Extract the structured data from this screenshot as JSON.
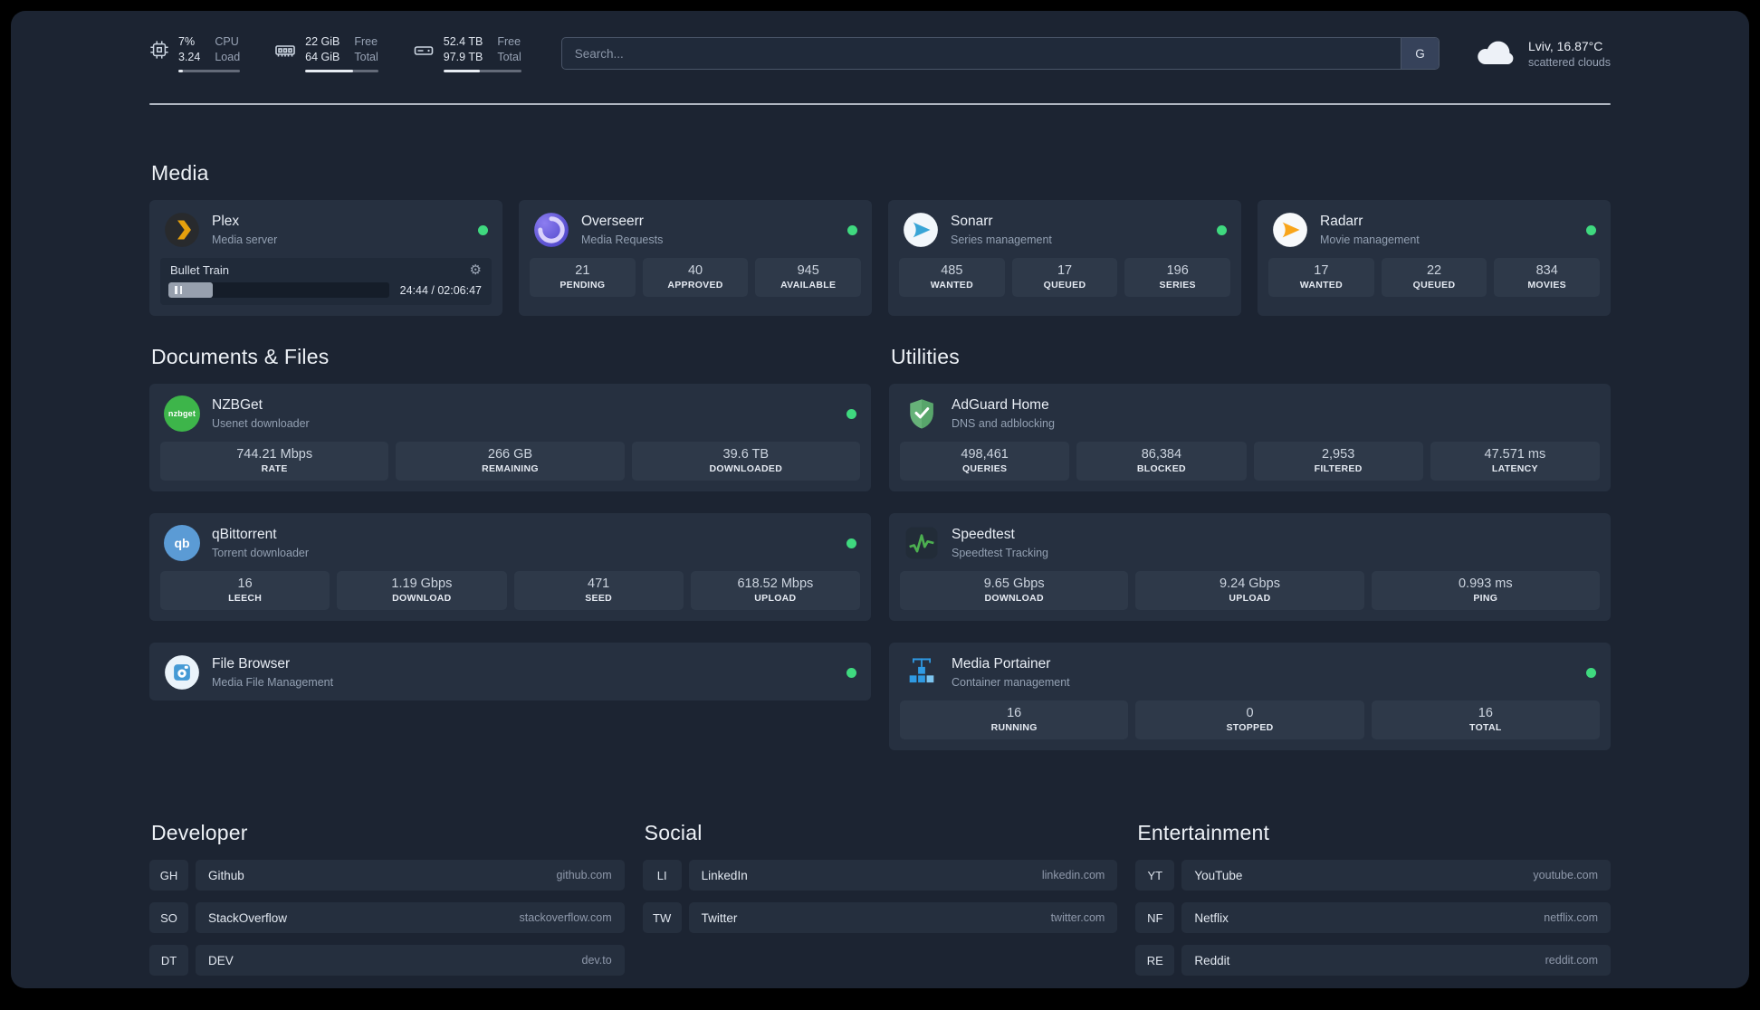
{
  "icons": {
    "gear": "⚙"
  },
  "topbar": {
    "cpu": {
      "value_top": "7%",
      "value_bottom": "3.24",
      "label_top": "CPU",
      "label_bottom": "Load",
      "progress": 7
    },
    "memory": {
      "value_top": "22 GiB",
      "value_bottom": "64 GiB",
      "label_top": "Free",
      "label_bottom": "Total",
      "progress": 66
    },
    "disk": {
      "value_top": "52.4 TB",
      "value_bottom": "97.9 TB",
      "label_top": "Free",
      "label_bottom": "Total",
      "progress": 47
    },
    "search": {
      "placeholder": "Search...",
      "provider_label": "G"
    },
    "weather": {
      "location": "Lviv, 16.87°C",
      "condition": "scattered clouds"
    }
  },
  "sections": {
    "media": {
      "title": "Media",
      "plex": {
        "title": "Plex",
        "subtitle": "Media server",
        "now_playing": "Bullet Train",
        "time": "24:44 / 02:06:47",
        "progress_pct": 20
      },
      "overseerr": {
        "title": "Overseerr",
        "subtitle": "Media Requests",
        "stats": [
          {
            "value": "21",
            "label": "PENDING"
          },
          {
            "value": "40",
            "label": "APPROVED"
          },
          {
            "value": "945",
            "label": "AVAILABLE"
          }
        ]
      },
      "sonarr": {
        "title": "Sonarr",
        "subtitle": "Series management",
        "stats": [
          {
            "value": "485",
            "label": "WANTED"
          },
          {
            "value": "17",
            "label": "QUEUED"
          },
          {
            "value": "196",
            "label": "SERIES"
          }
        ]
      },
      "radarr": {
        "title": "Radarr",
        "subtitle": "Movie management",
        "stats": [
          {
            "value": "17",
            "label": "WANTED"
          },
          {
            "value": "22",
            "label": "QUEUED"
          },
          {
            "value": "834",
            "label": "MOVIES"
          }
        ]
      }
    },
    "documents": {
      "title": "Documents & Files",
      "nzbget": {
        "title": "NZBGet",
        "subtitle": "Usenet downloader",
        "icon_text": "nzbget",
        "stats": [
          {
            "value": "744.21 Mbps",
            "label": "RATE"
          },
          {
            "value": "266 GB",
            "label": "REMAINING"
          },
          {
            "value": "39.6 TB",
            "label": "DOWNLOADED"
          }
        ]
      },
      "qbittorrent": {
        "title": "qBittorrent",
        "subtitle": "Torrent downloader",
        "icon_text": "qb",
        "stats": [
          {
            "value": "16",
            "label": "LEECH"
          },
          {
            "value": "1.19 Gbps",
            "label": "DOWNLOAD"
          },
          {
            "value": "471",
            "label": "SEED"
          },
          {
            "value": "618.52 Mbps",
            "label": "UPLOAD"
          }
        ]
      },
      "filebrowser": {
        "title": "File Browser",
        "subtitle": "Media File Management"
      }
    },
    "utilities": {
      "title": "Utilities",
      "adguard": {
        "title": "AdGuard Home",
        "subtitle": "DNS and adblocking",
        "stats": [
          {
            "value": "498,461",
            "label": "QUERIES"
          },
          {
            "value": "86,384",
            "label": "BLOCKED"
          },
          {
            "value": "2,953",
            "label": "FILTERED"
          },
          {
            "value": "47.571 ms",
            "label": "LATENCY"
          }
        ]
      },
      "speedtest": {
        "title": "Speedtest",
        "subtitle": "Speedtest Tracking",
        "stats": [
          {
            "value": "9.65 Gbps",
            "label": "DOWNLOAD"
          },
          {
            "value": "9.24 Gbps",
            "label": "UPLOAD"
          },
          {
            "value": "0.993 ms",
            "label": "PING"
          }
        ]
      },
      "portainer": {
        "title": "Media Portainer",
        "subtitle": "Container management",
        "stats": [
          {
            "value": "16",
            "label": "RUNNING"
          },
          {
            "value": "0",
            "label": "STOPPED"
          },
          {
            "value": "16",
            "label": "TOTAL"
          }
        ]
      }
    }
  },
  "bookmarks": {
    "developer": {
      "title": "Developer",
      "items": [
        {
          "abbr": "GH",
          "name": "Github",
          "url": "github.com"
        },
        {
          "abbr": "SO",
          "name": "StackOverflow",
          "url": "stackoverflow.com"
        },
        {
          "abbr": "DT",
          "name": "DEV",
          "url": "dev.to"
        }
      ]
    },
    "social": {
      "title": "Social",
      "items": [
        {
          "abbr": "LI",
          "name": "LinkedIn",
          "url": "linkedin.com"
        },
        {
          "abbr": "TW",
          "name": "Twitter",
          "url": "twitter.com"
        }
      ]
    },
    "entertainment": {
      "title": "Entertainment",
      "items": [
        {
          "abbr": "YT",
          "name": "YouTube",
          "url": "youtube.com"
        },
        {
          "abbr": "NF",
          "name": "Netflix",
          "url": "netflix.com"
        },
        {
          "abbr": "RE",
          "name": "Reddit",
          "url": "reddit.com"
        }
      ]
    }
  }
}
